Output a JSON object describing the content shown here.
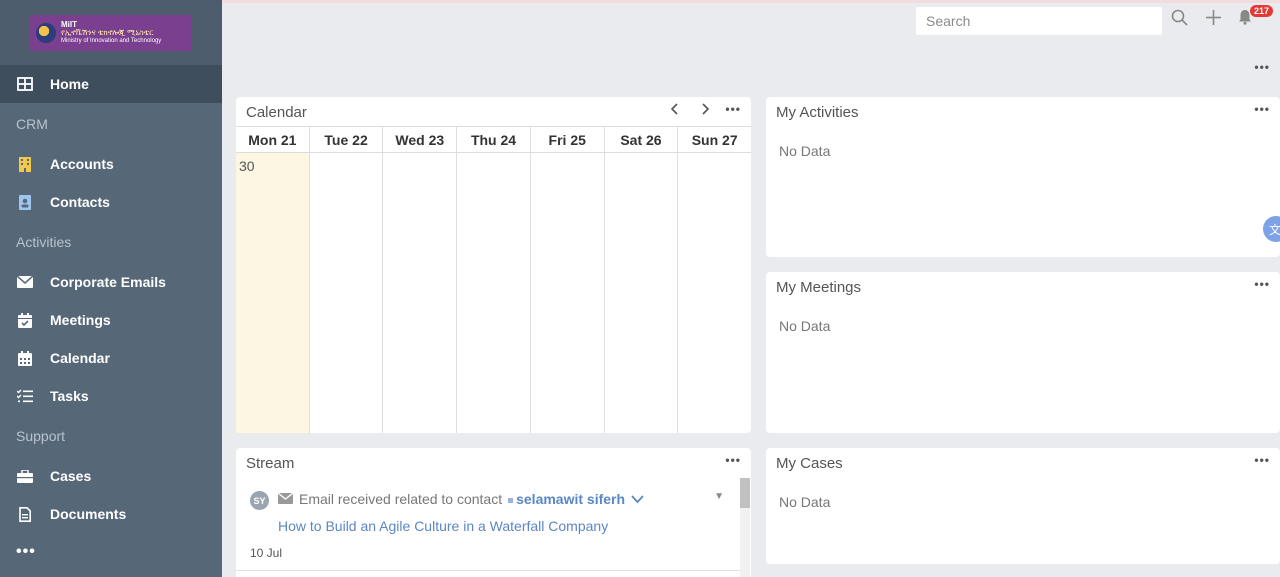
{
  "logo": {
    "line1": "MiIT",
    "line2": "የኢኖቬሽንና ቴክኖሎጂ ሚኒስቴር",
    "line3": "Ministry of Innovation and Technology"
  },
  "sidebar": {
    "home": "Home",
    "groups": {
      "crm": "CRM",
      "activities": "Activities",
      "support": "Support"
    },
    "items": {
      "accounts": "Accounts",
      "contacts": "Contacts",
      "corporate_emails": "Corporate Emails",
      "meetings": "Meetings",
      "calendar": "Calendar",
      "tasks": "Tasks",
      "cases": "Cases",
      "documents": "Documents"
    },
    "more": "•••"
  },
  "topbar": {
    "search_placeholder": "Search",
    "notification_count": "217"
  },
  "calendar": {
    "title": "Calendar",
    "days": [
      "Mon 21",
      "Tue 22",
      "Wed 23",
      "Thu 24",
      "Fri 25",
      "Sat 26",
      "Sun 27"
    ],
    "today_number": "30"
  },
  "activities": {
    "title": "My Activities",
    "empty": "No Data"
  },
  "meetings": {
    "title": "My Meetings",
    "empty": "No Data"
  },
  "cases": {
    "title": "My Cases",
    "empty": "No Data"
  },
  "stream": {
    "title": "Stream",
    "item": {
      "avatar": "SY",
      "text": "Email received related to contact",
      "contact": "selamawit siferh",
      "subject": "How to Build an Agile Culture in a Waterfall Company",
      "date": "10 Jul"
    }
  },
  "colors": {
    "sidebar": "#566778",
    "active": "#3f4e5d",
    "link": "#5b87c5",
    "today": "#fcf6e3",
    "badge": "#e53935"
  },
  "icons": {
    "home": "grid-icon",
    "accounts": "building-icon",
    "contacts": "contact-card-icon",
    "emails": "envelope-icon",
    "meetings": "calendar-check-icon",
    "calendar": "calendar-icon",
    "tasks": "checklist-icon",
    "cases": "briefcase-icon",
    "documents": "document-icon",
    "search": "search-icon",
    "add": "plus-icon",
    "notifications": "bell-icon"
  }
}
